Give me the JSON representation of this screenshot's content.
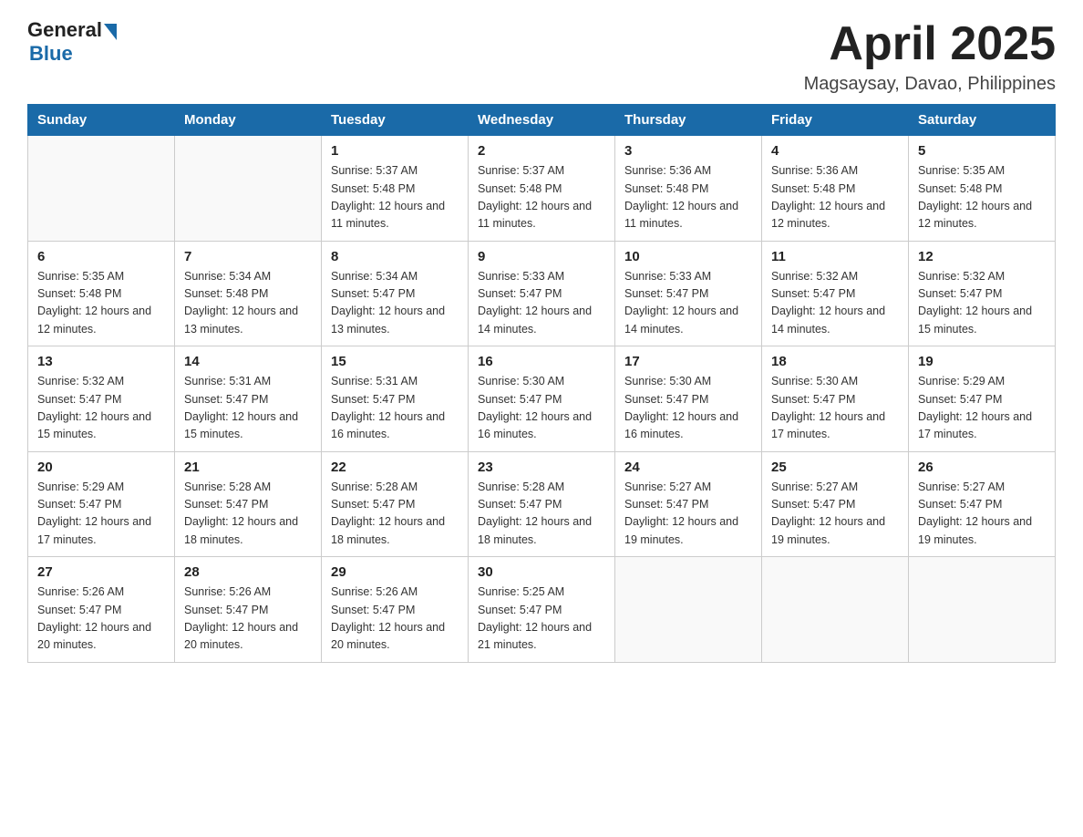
{
  "header": {
    "logo": {
      "general": "General",
      "blue": "Blue",
      "triangle": "▶"
    },
    "title": "April 2025",
    "subtitle": "Magsaysay, Davao, Philippines"
  },
  "calendar": {
    "headers": [
      "Sunday",
      "Monday",
      "Tuesday",
      "Wednesday",
      "Thursday",
      "Friday",
      "Saturday"
    ],
    "weeks": [
      [
        {
          "day": "",
          "sunrise": "",
          "sunset": "",
          "daylight": ""
        },
        {
          "day": "",
          "sunrise": "",
          "sunset": "",
          "daylight": ""
        },
        {
          "day": "1",
          "sunrise": "Sunrise: 5:37 AM",
          "sunset": "Sunset: 5:48 PM",
          "daylight": "Daylight: 12 hours and 11 minutes."
        },
        {
          "day": "2",
          "sunrise": "Sunrise: 5:37 AM",
          "sunset": "Sunset: 5:48 PM",
          "daylight": "Daylight: 12 hours and 11 minutes."
        },
        {
          "day": "3",
          "sunrise": "Sunrise: 5:36 AM",
          "sunset": "Sunset: 5:48 PM",
          "daylight": "Daylight: 12 hours and 11 minutes."
        },
        {
          "day": "4",
          "sunrise": "Sunrise: 5:36 AM",
          "sunset": "Sunset: 5:48 PM",
          "daylight": "Daylight: 12 hours and 12 minutes."
        },
        {
          "day": "5",
          "sunrise": "Sunrise: 5:35 AM",
          "sunset": "Sunset: 5:48 PM",
          "daylight": "Daylight: 12 hours and 12 minutes."
        }
      ],
      [
        {
          "day": "6",
          "sunrise": "Sunrise: 5:35 AM",
          "sunset": "Sunset: 5:48 PM",
          "daylight": "Daylight: 12 hours and 12 minutes."
        },
        {
          "day": "7",
          "sunrise": "Sunrise: 5:34 AM",
          "sunset": "Sunset: 5:48 PM",
          "daylight": "Daylight: 12 hours and 13 minutes."
        },
        {
          "day": "8",
          "sunrise": "Sunrise: 5:34 AM",
          "sunset": "Sunset: 5:47 PM",
          "daylight": "Daylight: 12 hours and 13 minutes."
        },
        {
          "day": "9",
          "sunrise": "Sunrise: 5:33 AM",
          "sunset": "Sunset: 5:47 PM",
          "daylight": "Daylight: 12 hours and 14 minutes."
        },
        {
          "day": "10",
          "sunrise": "Sunrise: 5:33 AM",
          "sunset": "Sunset: 5:47 PM",
          "daylight": "Daylight: 12 hours and 14 minutes."
        },
        {
          "day": "11",
          "sunrise": "Sunrise: 5:32 AM",
          "sunset": "Sunset: 5:47 PM",
          "daylight": "Daylight: 12 hours and 14 minutes."
        },
        {
          "day": "12",
          "sunrise": "Sunrise: 5:32 AM",
          "sunset": "Sunset: 5:47 PM",
          "daylight": "Daylight: 12 hours and 15 minutes."
        }
      ],
      [
        {
          "day": "13",
          "sunrise": "Sunrise: 5:32 AM",
          "sunset": "Sunset: 5:47 PM",
          "daylight": "Daylight: 12 hours and 15 minutes."
        },
        {
          "day": "14",
          "sunrise": "Sunrise: 5:31 AM",
          "sunset": "Sunset: 5:47 PM",
          "daylight": "Daylight: 12 hours and 15 minutes."
        },
        {
          "day": "15",
          "sunrise": "Sunrise: 5:31 AM",
          "sunset": "Sunset: 5:47 PM",
          "daylight": "Daylight: 12 hours and 16 minutes."
        },
        {
          "day": "16",
          "sunrise": "Sunrise: 5:30 AM",
          "sunset": "Sunset: 5:47 PM",
          "daylight": "Daylight: 12 hours and 16 minutes."
        },
        {
          "day": "17",
          "sunrise": "Sunrise: 5:30 AM",
          "sunset": "Sunset: 5:47 PM",
          "daylight": "Daylight: 12 hours and 16 minutes."
        },
        {
          "day": "18",
          "sunrise": "Sunrise: 5:30 AM",
          "sunset": "Sunset: 5:47 PM",
          "daylight": "Daylight: 12 hours and 17 minutes."
        },
        {
          "day": "19",
          "sunrise": "Sunrise: 5:29 AM",
          "sunset": "Sunset: 5:47 PM",
          "daylight": "Daylight: 12 hours and 17 minutes."
        }
      ],
      [
        {
          "day": "20",
          "sunrise": "Sunrise: 5:29 AM",
          "sunset": "Sunset: 5:47 PM",
          "daylight": "Daylight: 12 hours and 17 minutes."
        },
        {
          "day": "21",
          "sunrise": "Sunrise: 5:28 AM",
          "sunset": "Sunset: 5:47 PM",
          "daylight": "Daylight: 12 hours and 18 minutes."
        },
        {
          "day": "22",
          "sunrise": "Sunrise: 5:28 AM",
          "sunset": "Sunset: 5:47 PM",
          "daylight": "Daylight: 12 hours and 18 minutes."
        },
        {
          "day": "23",
          "sunrise": "Sunrise: 5:28 AM",
          "sunset": "Sunset: 5:47 PM",
          "daylight": "Daylight: 12 hours and 18 minutes."
        },
        {
          "day": "24",
          "sunrise": "Sunrise: 5:27 AM",
          "sunset": "Sunset: 5:47 PM",
          "daylight": "Daylight: 12 hours and 19 minutes."
        },
        {
          "day": "25",
          "sunrise": "Sunrise: 5:27 AM",
          "sunset": "Sunset: 5:47 PM",
          "daylight": "Daylight: 12 hours and 19 minutes."
        },
        {
          "day": "26",
          "sunrise": "Sunrise: 5:27 AM",
          "sunset": "Sunset: 5:47 PM",
          "daylight": "Daylight: 12 hours and 19 minutes."
        }
      ],
      [
        {
          "day": "27",
          "sunrise": "Sunrise: 5:26 AM",
          "sunset": "Sunset: 5:47 PM",
          "daylight": "Daylight: 12 hours and 20 minutes."
        },
        {
          "day": "28",
          "sunrise": "Sunrise: 5:26 AM",
          "sunset": "Sunset: 5:47 PM",
          "daylight": "Daylight: 12 hours and 20 minutes."
        },
        {
          "day": "29",
          "sunrise": "Sunrise: 5:26 AM",
          "sunset": "Sunset: 5:47 PM",
          "daylight": "Daylight: 12 hours and 20 minutes."
        },
        {
          "day": "30",
          "sunrise": "Sunrise: 5:25 AM",
          "sunset": "Sunset: 5:47 PM",
          "daylight": "Daylight: 12 hours and 21 minutes."
        },
        {
          "day": "",
          "sunrise": "",
          "sunset": "",
          "daylight": ""
        },
        {
          "day": "",
          "sunrise": "",
          "sunset": "",
          "daylight": ""
        },
        {
          "day": "",
          "sunrise": "",
          "sunset": "",
          "daylight": ""
        }
      ]
    ]
  }
}
